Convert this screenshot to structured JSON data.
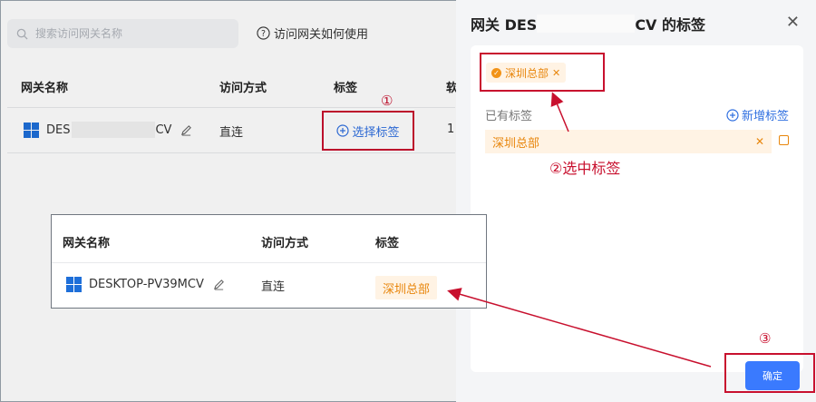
{
  "search": {
    "placeholder": "搜索访问网关名称"
  },
  "help_link": "访问网关如何使用",
  "table": {
    "headers": [
      "网关名称",
      "访问方式",
      "标签",
      "软"
    ],
    "row": {
      "name_prefix": "DES",
      "name_suffix": "CV",
      "access": "直连",
      "select_tag_label": "选择标签",
      "next_col": "1"
    }
  },
  "panel": {
    "title_prefix": "网关 DES",
    "title_suffix": "CV 的标签",
    "selected_chip": "深圳总部",
    "existing_label": "已有标签",
    "add_tag_label": "新增标签",
    "existing_tags": [
      "深圳总部"
    ],
    "confirm_label": "确定"
  },
  "result_table": {
    "headers": [
      "网关名称",
      "访问方式",
      "标签"
    ],
    "row": {
      "name": "DESKTOP-PV39MCV",
      "access": "直连",
      "tag": "深圳总部"
    }
  },
  "annotations": {
    "step1": "①",
    "step2": "②选中标签",
    "step3": "③"
  },
  "colors": {
    "accent": "#3a7afe",
    "tag_text": "#e8860c",
    "tag_bg": "#fff3e4",
    "annotation": "#c8102e"
  }
}
